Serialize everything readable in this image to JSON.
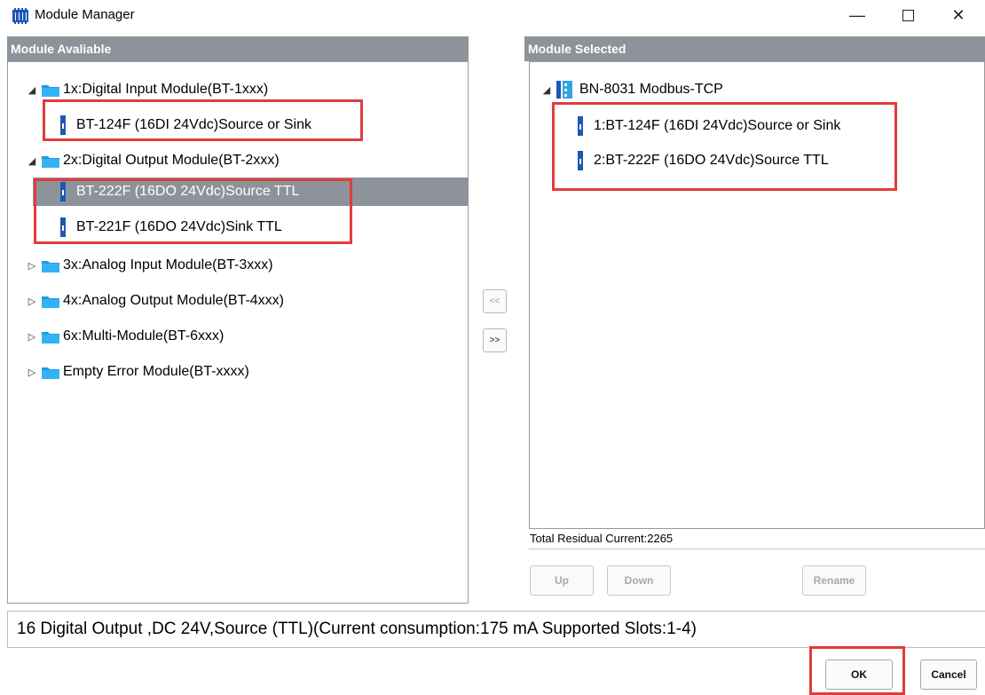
{
  "window": {
    "title": "Module Manager"
  },
  "left_panel": {
    "header": "Module Avaliable",
    "tree": [
      {
        "label": "1x:Digital Input Module(BT-1xxx)",
        "expanded": true,
        "children": [
          "BT-124F (16DI 24Vdc)Source or Sink"
        ]
      },
      {
        "label": "2x:Digital Output Module(BT-2xxx)",
        "expanded": true,
        "children": [
          "BT-222F (16DO 24Vdc)Source TTL",
          "BT-221F (16DO 24Vdc)Sink TTL"
        ]
      },
      {
        "label": "3x:Analog Input Module(BT-3xxx)",
        "expanded": false
      },
      {
        "label": "4x:Analog Output Module(BT-4xxx)",
        "expanded": false
      },
      {
        "label": "6x:Multi-Module(BT-6xxx)",
        "expanded": false
      },
      {
        "label": "Empty Error Module(BT-xxxx)",
        "expanded": false
      }
    ],
    "selected": "BT-222F (16DO 24Vdc)Source TTL"
  },
  "transfer": {
    "remove_label": "<<",
    "add_label": ">>"
  },
  "right_panel": {
    "header": "Module Selected",
    "root": "BN-8031 Modbus-TCP",
    "children": [
      "1:BT-124F (16DI 24Vdc)Source or Sink",
      "2:BT-222F (16DO 24Vdc)Source TTL"
    ],
    "residual": "Total Residual Current:2265"
  },
  "buttons": {
    "up": "Up",
    "down": "Down",
    "rename": "Rename",
    "ok": "OK",
    "cancel": "Cancel"
  },
  "description": "16 Digital Output ,DC 24V,Source (TTL)(Current consumption:175 mA  Supported Slots:1-4)",
  "colors": {
    "header_bg": "#8d939b",
    "selection_bg": "#8d939b",
    "highlight_red": "#e33b3b",
    "folder_blue": "#1e9be6",
    "module_blue": "#1f57b5"
  }
}
